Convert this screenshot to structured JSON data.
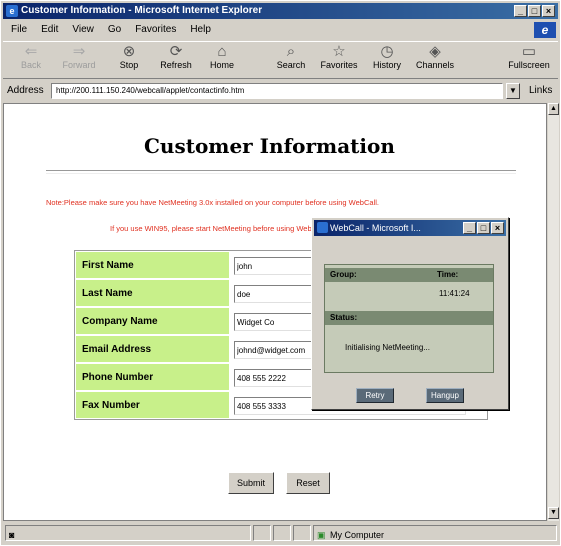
{
  "window": {
    "title": "Customer Information - Microsoft Internet Explorer"
  },
  "menu": [
    "File",
    "Edit",
    "View",
    "Go",
    "Favorites",
    "Help"
  ],
  "toolbar": [
    {
      "label": "Back",
      "icon": "back-arrow-icon",
      "enabled": false
    },
    {
      "label": "Forward",
      "icon": "forward-arrow-icon",
      "enabled": false
    },
    {
      "label": "Stop",
      "icon": "stop-icon",
      "enabled": true
    },
    {
      "label": "Refresh",
      "icon": "refresh-icon",
      "enabled": true
    },
    {
      "label": "Home",
      "icon": "home-icon",
      "enabled": true
    },
    {
      "label": "Search",
      "icon": "search-icon",
      "enabled": true
    },
    {
      "label": "Favorites",
      "icon": "favorites-icon",
      "enabled": true
    },
    {
      "label": "History",
      "icon": "history-icon",
      "enabled": true
    },
    {
      "label": "Channels",
      "icon": "channels-icon",
      "enabled": true
    },
    {
      "label": "Fullscreen",
      "icon": "fullscreen-icon",
      "enabled": true
    }
  ],
  "address": {
    "label": "Address",
    "url": "http://200.111.150.240/webcall/applet/contactinfo.htm",
    "links_label": "Links"
  },
  "page": {
    "title": "Customer Information",
    "note1": "Note:Please make sure you have NetMeeting 3.0x installed on your computer before using WebCall.",
    "note2": "If you use WIN95, please start NetMeeting before using WebCall.",
    "fields": [
      {
        "label": "First Name",
        "value": "john"
      },
      {
        "label": "Last Name",
        "value": "doe"
      },
      {
        "label": "Company Name",
        "value": "Widget Co"
      },
      {
        "label": "Email Address",
        "value": "johnd@widget.com"
      },
      {
        "label": "Phone Number",
        "value": "408 555 2222"
      },
      {
        "label": "Fax Number",
        "value": "408 555 3333"
      }
    ],
    "submit_label": "Submit",
    "reset_label": "Reset"
  },
  "status": {
    "zone": "My Computer"
  },
  "popup": {
    "title": "WebCall - Microsoft I...",
    "group_label": "Group:",
    "time_label": "Time:",
    "time_value": "11:41:24",
    "status_label": "Status:",
    "status_value": "Initialising NetMeeting...",
    "retry_label": "Retry",
    "hangup_label": "Hangup"
  }
}
